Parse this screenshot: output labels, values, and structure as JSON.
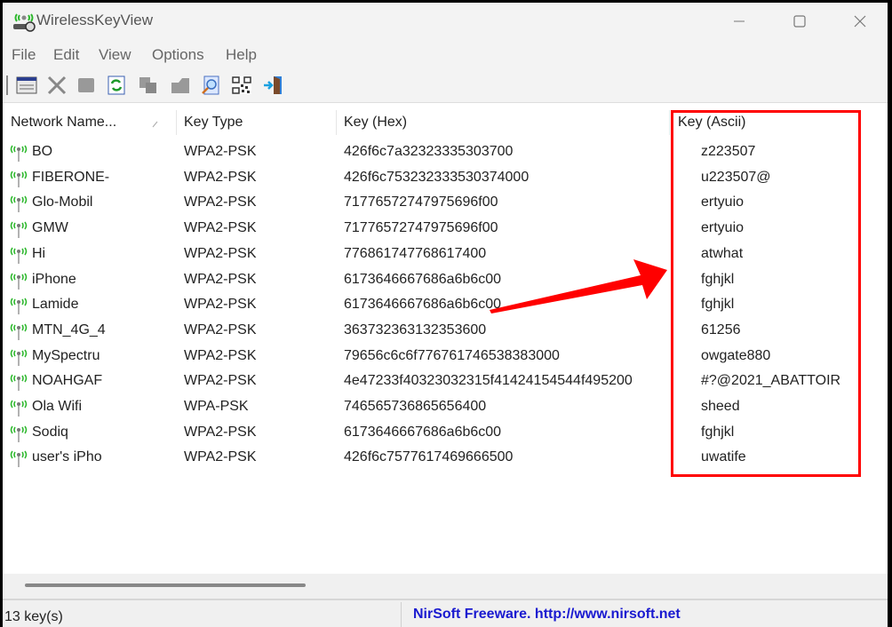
{
  "window": {
    "title": "WirelessKeyView",
    "controls": {
      "minimize": "minimize",
      "maximize": "maximize",
      "close": "close"
    }
  },
  "menu": [
    "File",
    "Edit",
    "View",
    "Options",
    "Help"
  ],
  "toolbar": {
    "buttons": [
      "properties-icon",
      "delete-icon",
      "stop-icon",
      "refresh-icon",
      "copy-icon",
      "export-icon",
      "find-icon",
      "qr-code-icon",
      "exit-icon"
    ]
  },
  "columns": [
    "Network Name...",
    "Key Type",
    "Key (Hex)",
    "Key (Ascii)"
  ],
  "rows": [
    {
      "name": "BO",
      "type": "WPA2-PSK",
      "hex": "426f6c7a32323335303700",
      "ascii": "z223507"
    },
    {
      "name": "FIBERONE-",
      "type": "WPA2-PSK",
      "hex": "426f6c753232333530374000",
      "ascii": "u223507@"
    },
    {
      "name": "Glo-Mobil",
      "type": "WPA2-PSK",
      "hex": "71776572747975696f00",
      "ascii": "ertyuio"
    },
    {
      "name": "GMW",
      "type": "WPA2-PSK",
      "hex": "71776572747975696f00",
      "ascii": "ertyuio"
    },
    {
      "name": "Hi",
      "type": "WPA2-PSK",
      "hex": "776861747768617400",
      "ascii": "atwhat"
    },
    {
      "name": "iPhone",
      "type": "WPA2-PSK",
      "hex": "6173646667686a6b6c00",
      "ascii": "fghjkl"
    },
    {
      "name": "Lamide",
      "type": "WPA2-PSK",
      "hex": "6173646667686a6b6c00",
      "ascii": "fghjkl"
    },
    {
      "name": "MTN_4G_4",
      "type": "WPA2-PSK",
      "hex": "363732363132353600",
      "ascii": "61256"
    },
    {
      "name": "MySpectru",
      "type": "WPA2-PSK",
      "hex": "79656c6c6f776761746538383000",
      "ascii": "owgate880"
    },
    {
      "name": "NOAHGAF",
      "type": "WPA2-PSK",
      "hex": "4e47233f40323032315f41424154544f495200",
      "ascii": "#?@2021_ABATTOIR"
    },
    {
      "name": "Ola Wifi",
      "type": "WPA-PSK",
      "hex": "746565736865656400",
      "ascii": "sheed"
    },
    {
      "name": "Sodiq",
      "type": "WPA2-PSK",
      "hex": "6173646667686a6b6c00",
      "ascii": "fghjkl"
    },
    {
      "name": "user's iPho",
      "type": "WPA2-PSK",
      "hex": "426f6c7577617469666500",
      "ascii": "uwatife"
    }
  ],
  "status": {
    "count": "13 key(s)",
    "credit": "NirSoft Freeware.  http://www.nirsoft.net"
  },
  "annotation": {
    "color": "#ff0000"
  }
}
